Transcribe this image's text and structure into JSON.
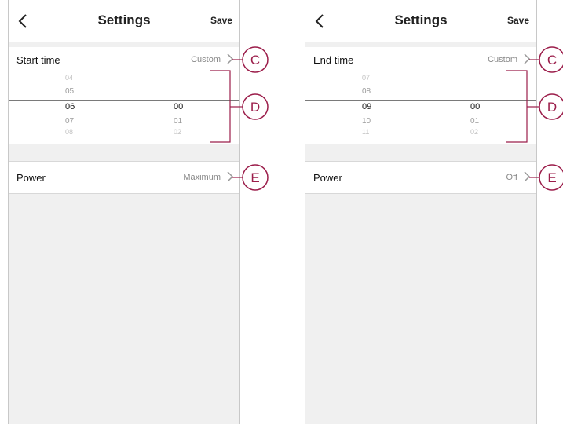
{
  "screens": [
    {
      "header": {
        "title": "Settings",
        "save_label": "Save"
      },
      "time_row": {
        "label": "Start time",
        "value": "Custom"
      },
      "picker": {
        "hours": [
          "04",
          "05",
          "06",
          "07",
          "08"
        ],
        "minutes": [
          "00",
          "01",
          "02"
        ]
      },
      "power_row": {
        "label": "Power",
        "value": "Maximum"
      }
    },
    {
      "header": {
        "title": "Settings",
        "save_label": "Save"
      },
      "time_row": {
        "label": "End time",
        "value": "Custom"
      },
      "picker": {
        "hours": [
          "07",
          "08",
          "09",
          "10",
          "11"
        ],
        "minutes": [
          "00",
          "01",
          "02"
        ]
      },
      "power_row": {
        "label": "Power",
        "value": "Off"
      }
    }
  ],
  "callouts": {
    "c": "C",
    "d": "D",
    "e": "E"
  },
  "icons": {
    "back": "chevron-left-icon",
    "row_arrow": "chevron-right-icon"
  },
  "colors": {
    "callout": "#9b1d4a",
    "background": "#f0f0f0"
  }
}
